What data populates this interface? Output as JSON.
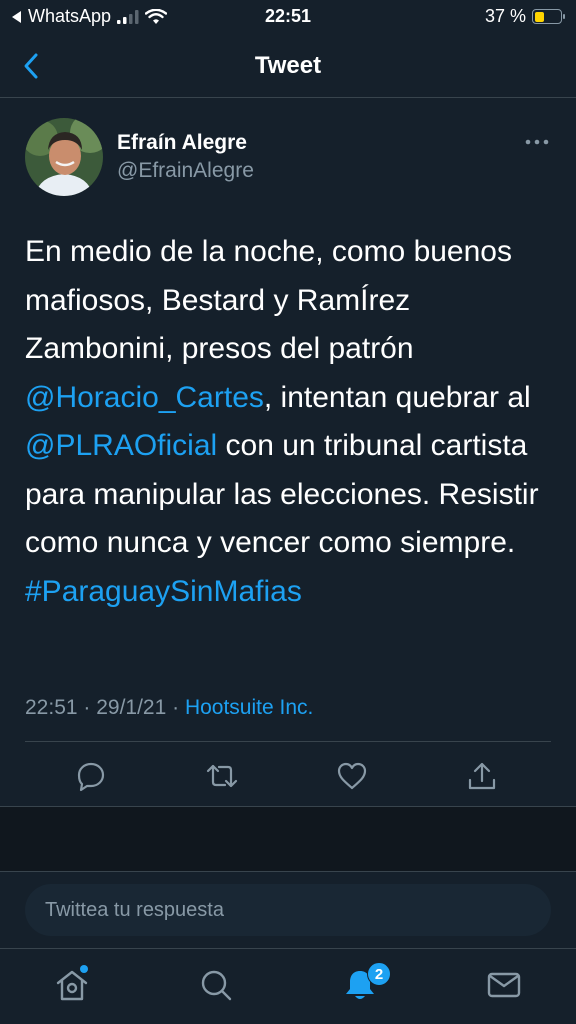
{
  "status_bar": {
    "carrier": "WhatsApp",
    "time": "22:51",
    "battery_percent": "37 %",
    "battery_level": 0.37
  },
  "header": {
    "title": "Tweet"
  },
  "tweet": {
    "author_name": "Efraín Alegre",
    "author_handle": "@EfrainAlegre",
    "text_1": "En medio de la noche, como buenos mafiosos, Bestard y RamÍrez Zambonini, presos del patrón ",
    "mention_1": "@Horacio_Cartes",
    "text_2": ", intentan quebrar al ",
    "mention_2": "@PLRAOficial",
    "text_3": " con un tribunal cartista para manipular las elecciones. Resistir como nunca y vencer como siempre. ",
    "hashtag": "#ParaguaySinMafias",
    "timestamp": "22:51 · 29/1/21 · ",
    "source": "Hootsuite Inc."
  },
  "reply": {
    "placeholder": "Twittea tu respuesta"
  },
  "tab_bar": {
    "notification_count": "2"
  },
  "colors": {
    "background": "#15202b",
    "accent": "#1da1f2",
    "secondary_text": "#8899a6",
    "divider": "#38444d"
  }
}
